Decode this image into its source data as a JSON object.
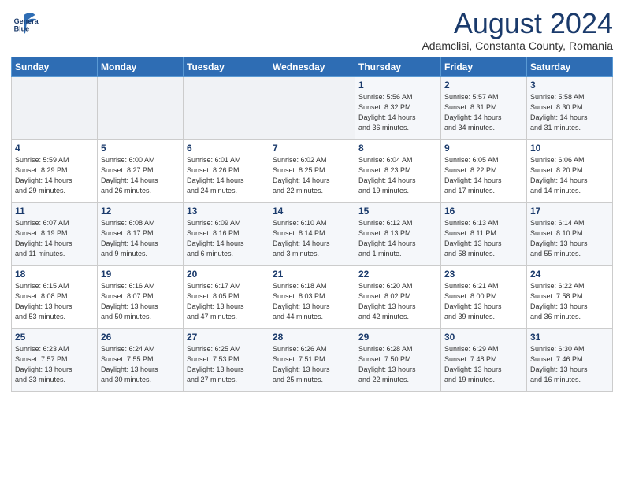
{
  "header": {
    "logo_line1": "General",
    "logo_line2": "Blue",
    "month": "August 2024",
    "location": "Adamclisi, Constanta County, Romania"
  },
  "weekdays": [
    "Sunday",
    "Monday",
    "Tuesday",
    "Wednesday",
    "Thursday",
    "Friday",
    "Saturday"
  ],
  "weeks": [
    [
      {
        "day": "",
        "info": ""
      },
      {
        "day": "",
        "info": ""
      },
      {
        "day": "",
        "info": ""
      },
      {
        "day": "",
        "info": ""
      },
      {
        "day": "1",
        "info": "Sunrise: 5:56 AM\nSunset: 8:32 PM\nDaylight: 14 hours\nand 36 minutes."
      },
      {
        "day": "2",
        "info": "Sunrise: 5:57 AM\nSunset: 8:31 PM\nDaylight: 14 hours\nand 34 minutes."
      },
      {
        "day": "3",
        "info": "Sunrise: 5:58 AM\nSunset: 8:30 PM\nDaylight: 14 hours\nand 31 minutes."
      }
    ],
    [
      {
        "day": "4",
        "info": "Sunrise: 5:59 AM\nSunset: 8:29 PM\nDaylight: 14 hours\nand 29 minutes."
      },
      {
        "day": "5",
        "info": "Sunrise: 6:00 AM\nSunset: 8:27 PM\nDaylight: 14 hours\nand 26 minutes."
      },
      {
        "day": "6",
        "info": "Sunrise: 6:01 AM\nSunset: 8:26 PM\nDaylight: 14 hours\nand 24 minutes."
      },
      {
        "day": "7",
        "info": "Sunrise: 6:02 AM\nSunset: 8:25 PM\nDaylight: 14 hours\nand 22 minutes."
      },
      {
        "day": "8",
        "info": "Sunrise: 6:04 AM\nSunset: 8:23 PM\nDaylight: 14 hours\nand 19 minutes."
      },
      {
        "day": "9",
        "info": "Sunrise: 6:05 AM\nSunset: 8:22 PM\nDaylight: 14 hours\nand 17 minutes."
      },
      {
        "day": "10",
        "info": "Sunrise: 6:06 AM\nSunset: 8:20 PM\nDaylight: 14 hours\nand 14 minutes."
      }
    ],
    [
      {
        "day": "11",
        "info": "Sunrise: 6:07 AM\nSunset: 8:19 PM\nDaylight: 14 hours\nand 11 minutes."
      },
      {
        "day": "12",
        "info": "Sunrise: 6:08 AM\nSunset: 8:17 PM\nDaylight: 14 hours\nand 9 minutes."
      },
      {
        "day": "13",
        "info": "Sunrise: 6:09 AM\nSunset: 8:16 PM\nDaylight: 14 hours\nand 6 minutes."
      },
      {
        "day": "14",
        "info": "Sunrise: 6:10 AM\nSunset: 8:14 PM\nDaylight: 14 hours\nand 3 minutes."
      },
      {
        "day": "15",
        "info": "Sunrise: 6:12 AM\nSunset: 8:13 PM\nDaylight: 14 hours\nand 1 minute."
      },
      {
        "day": "16",
        "info": "Sunrise: 6:13 AM\nSunset: 8:11 PM\nDaylight: 13 hours\nand 58 minutes."
      },
      {
        "day": "17",
        "info": "Sunrise: 6:14 AM\nSunset: 8:10 PM\nDaylight: 13 hours\nand 55 minutes."
      }
    ],
    [
      {
        "day": "18",
        "info": "Sunrise: 6:15 AM\nSunset: 8:08 PM\nDaylight: 13 hours\nand 53 minutes."
      },
      {
        "day": "19",
        "info": "Sunrise: 6:16 AM\nSunset: 8:07 PM\nDaylight: 13 hours\nand 50 minutes."
      },
      {
        "day": "20",
        "info": "Sunrise: 6:17 AM\nSunset: 8:05 PM\nDaylight: 13 hours\nand 47 minutes."
      },
      {
        "day": "21",
        "info": "Sunrise: 6:18 AM\nSunset: 8:03 PM\nDaylight: 13 hours\nand 44 minutes."
      },
      {
        "day": "22",
        "info": "Sunrise: 6:20 AM\nSunset: 8:02 PM\nDaylight: 13 hours\nand 42 minutes."
      },
      {
        "day": "23",
        "info": "Sunrise: 6:21 AM\nSunset: 8:00 PM\nDaylight: 13 hours\nand 39 minutes."
      },
      {
        "day": "24",
        "info": "Sunrise: 6:22 AM\nSunset: 7:58 PM\nDaylight: 13 hours\nand 36 minutes."
      }
    ],
    [
      {
        "day": "25",
        "info": "Sunrise: 6:23 AM\nSunset: 7:57 PM\nDaylight: 13 hours\nand 33 minutes."
      },
      {
        "day": "26",
        "info": "Sunrise: 6:24 AM\nSunset: 7:55 PM\nDaylight: 13 hours\nand 30 minutes."
      },
      {
        "day": "27",
        "info": "Sunrise: 6:25 AM\nSunset: 7:53 PM\nDaylight: 13 hours\nand 27 minutes."
      },
      {
        "day": "28",
        "info": "Sunrise: 6:26 AM\nSunset: 7:51 PM\nDaylight: 13 hours\nand 25 minutes."
      },
      {
        "day": "29",
        "info": "Sunrise: 6:28 AM\nSunset: 7:50 PM\nDaylight: 13 hours\nand 22 minutes."
      },
      {
        "day": "30",
        "info": "Sunrise: 6:29 AM\nSunset: 7:48 PM\nDaylight: 13 hours\nand 19 minutes."
      },
      {
        "day": "31",
        "info": "Sunrise: 6:30 AM\nSunset: 7:46 PM\nDaylight: 13 hours\nand 16 minutes."
      }
    ]
  ]
}
